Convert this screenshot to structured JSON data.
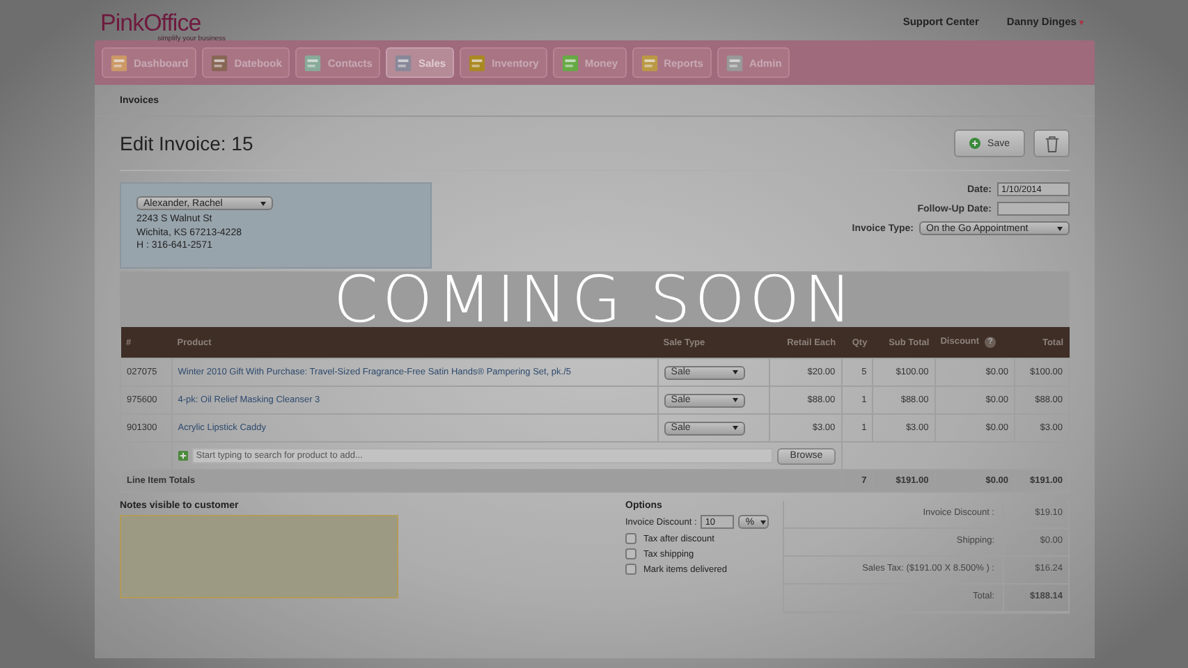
{
  "logo": {
    "name": "PinkOffice",
    "tagline": "simplify your business"
  },
  "top_links": [
    {
      "label": "Support Center"
    },
    {
      "label": "Danny Dinges",
      "caret": "▾"
    }
  ],
  "nav": [
    {
      "label": "Dashboard",
      "selected": false
    },
    {
      "label": "Datebook",
      "selected": false
    },
    {
      "label": "Contacts",
      "selected": false
    },
    {
      "label": "Sales",
      "selected": true
    },
    {
      "label": "Inventory",
      "selected": false
    },
    {
      "label": "Money",
      "selected": false
    },
    {
      "label": "Reports",
      "selected": false
    },
    {
      "label": "Admin",
      "selected": false
    }
  ],
  "breadcrumb": "Invoices",
  "title": "Edit Invoice: 15",
  "actions": {
    "save": "Save"
  },
  "customer": {
    "name": "Alexander, Rachel",
    "lines": [
      "2243 S Walnut St",
      "Wichita, KS 67213-4228",
      "H : 316-641-2571"
    ]
  },
  "fields": [
    {
      "label": "Date:",
      "value": "1/10/2014",
      "kind": "input"
    },
    {
      "label": "Follow-Up Date:",
      "kind": "input"
    },
    {
      "label": "Invoice Type:",
      "value": "On the Go Appointment",
      "kind": "select"
    }
  ],
  "table": {
    "columns": [
      "#",
      "Product",
      "Sale Type",
      "Retail Each",
      "Qty",
      "Sub Total",
      "Discount",
      "Total"
    ],
    "discount_help": "?",
    "rows": [
      {
        "id": "027075",
        "product": "Winter 2010 Gift With Purchase: Travel-Sized Fragrance-Free Satin Hands® Pampering Set, pk./5",
        "sale_type": "Sale",
        "retail": "$20.00",
        "qty": "5",
        "sub_total": "$100.00",
        "discount": "$0.00",
        "total": "$100.00"
      },
      {
        "id": "975600",
        "product": "4-pk: Oil Relief Masking Cleanser 3",
        "sale_type": "Sale",
        "retail": "$88.00",
        "qty": "1",
        "sub_total": "$88.00",
        "discount": "$0.00",
        "total": "$88.00"
      },
      {
        "id": "901300",
        "product": "Acrylic Lipstick Caddy",
        "sale_type": "Sale",
        "retail": "$3.00",
        "qty": "1",
        "sub_total": "$3.00",
        "discount": "$0.00",
        "total": "$3.00"
      }
    ],
    "add_placeholder": "Start typing to search for product to add...",
    "browse": "Browse",
    "totals": {
      "label": "Line Item Totals",
      "qty": "7",
      "sub_total": "$191.00",
      "discount": "$0.00",
      "total": "$191.00"
    }
  },
  "notes": {
    "label": "Notes visible to customer"
  },
  "options": {
    "title": "Options",
    "discount_label": "Invoice Discount :",
    "discount_value": "10",
    "discount_unit": "%",
    "checks": [
      {
        "label": "Tax after discount",
        "checked": false
      },
      {
        "label": "Tax shipping",
        "checked": false
      },
      {
        "label": "Mark items delivered",
        "checked": false
      }
    ]
  },
  "summary": [
    {
      "label": "Invoice Discount :",
      "value": "$19.10",
      "bold": false
    },
    {
      "label": "Shipping:",
      "value": "$0.00",
      "bold": false
    },
    {
      "label": "Sales Tax: ($191.00 X 8.500% ) :",
      "value": "$16.24",
      "bold": false
    },
    {
      "label": "Total:",
      "value": "$188.14",
      "bold": true
    }
  ],
  "overlay": "COMING SOON"
}
